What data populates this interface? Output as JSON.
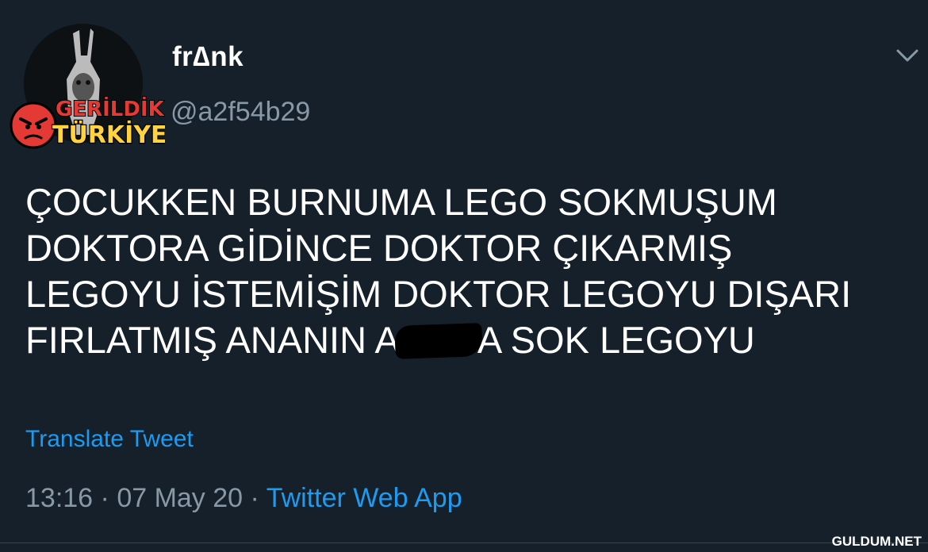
{
  "user": {
    "display_name": "fr∆nk",
    "handle": "@a2f54b29"
  },
  "overlay_logo": {
    "line1": "GERİLDİK",
    "line2": "TÜRKİYE"
  },
  "tweet": {
    "lines": [
      "ÇOCUKKEN BURNUMA LEGO SOKMUŞUM",
      "DOKTORA GİDİNCE DOKTOR ÇIKARMIŞ",
      "LEGOYU İSTEMİŞİM DOKTOR LEGOYU DIŞARI",
      "FIRLATMIŞ ANANIN A",
      "A SOK LEGOYU"
    ],
    "translate_label": "Translate Tweet"
  },
  "meta": {
    "time": "13:16",
    "separator": " · ",
    "date": "07 May 20",
    "source": "Twitter Web App"
  },
  "site_watermark": "GULDUM.NET",
  "colors": {
    "background": "#15202b",
    "accent": "#1d9bf0",
    "secondary_text": "#8899a6"
  },
  "icons": {
    "chevron": "chevron-down-icon"
  }
}
